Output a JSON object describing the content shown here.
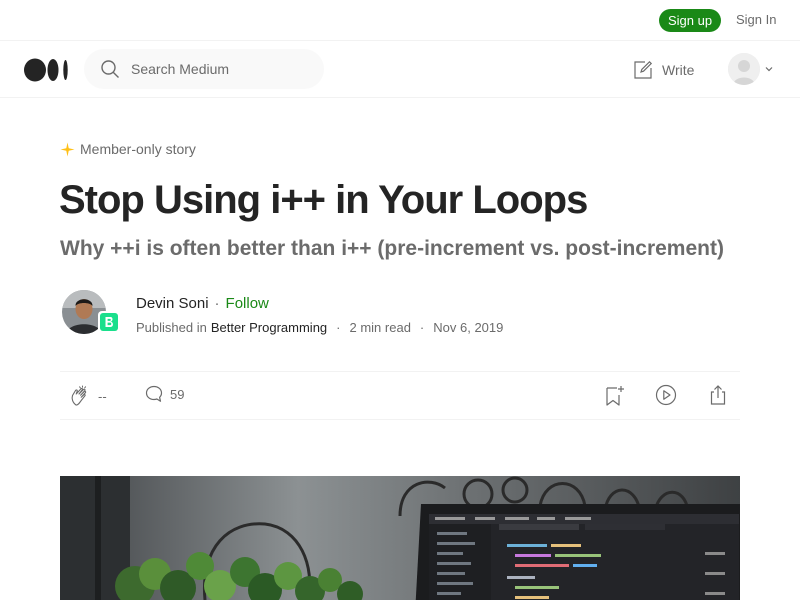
{
  "topbar": {
    "signup_label": "Sign up",
    "signin_label": "Sign In"
  },
  "nav": {
    "search_placeholder": "Search Medium",
    "write_label": "Write",
    "logo_icon": "medium-logo-icon",
    "search_icon": "search-icon",
    "write_icon": "write-icon",
    "avatar_icon": "user-avatar-icon"
  },
  "article": {
    "member_badge": "Member-only story",
    "title": "Stop Using i++ in Your Loops",
    "subtitle": "Why ++i is often better than i++ (pre-increment vs. post-increment)",
    "author": {
      "name": "Devin Soni",
      "follow_label": "Follow",
      "separator": "·"
    },
    "meta": {
      "published_in_label": "Published in",
      "publication": "Better Programming",
      "read_time": "2 min read",
      "date": "Nov 6, 2019"
    },
    "actions": {
      "claps": "--",
      "comments": "59",
      "clap_icon": "clap-icon",
      "comment_icon": "comment-icon",
      "save_icon": "bookmark-add-icon",
      "listen_icon": "play-icon",
      "share_icon": "share-icon"
    }
  },
  "colors": {
    "accent_green": "#1a8917",
    "text_primary": "#242424",
    "text_secondary": "#6b6b6b",
    "member_star": "#ffc017"
  }
}
